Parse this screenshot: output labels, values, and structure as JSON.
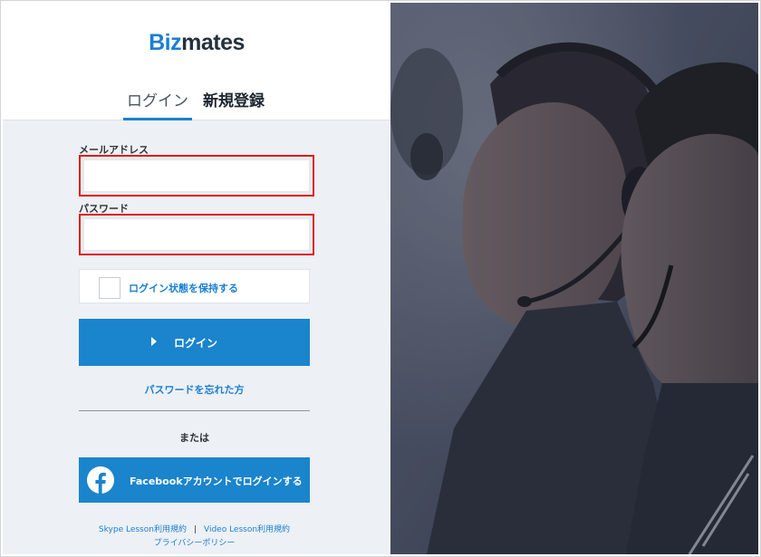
{
  "brand": {
    "part1": "Biz",
    "part2": "mates",
    "primary_color": "#1b7fd1",
    "dark_color": "#25313d"
  },
  "tabs": [
    {
      "label": "ログイン",
      "active": true
    },
    {
      "label": "新規登録",
      "active": false
    }
  ],
  "form": {
    "email_label": "メールアドレス",
    "email_value": "",
    "password_label": "パスワード",
    "password_value": "",
    "remember_label": "ログイン状態を保持する",
    "remember_checked": false,
    "login_button": "ログイン",
    "forgot_link": "パスワードを忘れた方",
    "or_text": "または",
    "facebook_button": "Facebookアカウントでログインする",
    "highlight_color": "#e01b1b"
  },
  "footer": {
    "skype_terms": "Skype Lesson利用規約",
    "separator": "|",
    "video_terms": "Video Lesson利用規約",
    "privacy": "プライバシーポリシー"
  }
}
